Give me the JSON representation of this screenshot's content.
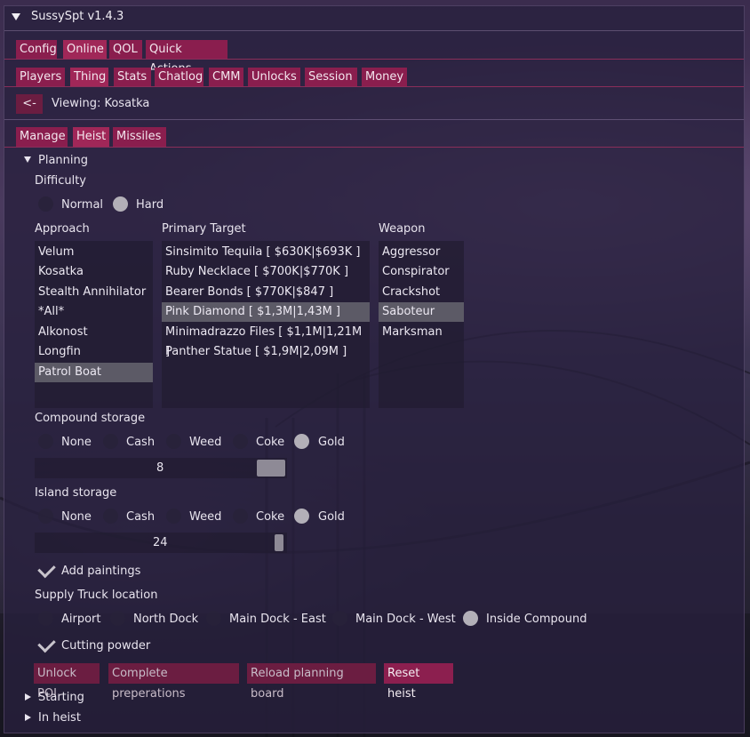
{
  "window": {
    "title": "SussySpt v1.4.3"
  },
  "tabs_row1": [
    "Config",
    "Online",
    "QOL",
    "Quick Actions"
  ],
  "tabs_row2": [
    "Players",
    "Thing",
    "Stats",
    "Chatlog",
    "CMM",
    "Unlocks",
    "Session",
    "Money"
  ],
  "nav": {
    "back_label": "<-",
    "viewing": "Viewing: Kosatka"
  },
  "tabs_row3": [
    "Manage",
    "Heist",
    "Missiles"
  ],
  "planning": {
    "header": "Planning",
    "difficulty_label": "Difficulty",
    "difficulty_options": [
      "Normal",
      "Hard"
    ],
    "difficulty_selected": "Hard",
    "approach_label": "Approach",
    "approach_items": [
      "Velum",
      "Kosatka",
      "Stealth Annihilator",
      "*All*",
      "Alkonost",
      "Longfin",
      "Patrol Boat"
    ],
    "approach_selected": "Patrol Boat",
    "target_label": "Primary Target",
    "target_items": [
      "Sinsimito Tequila [ $630K|$693K ]",
      "Ruby Necklace [ $700K|$770K ]",
      "Bearer Bonds [ $770K|$847 ]",
      "Pink Diamond [ $1,3M|1,43M ]",
      "Minimadrazzo Files [ $1,1M|1,21M ]",
      "Panther Statue [ $1,9M|2,09M ]"
    ],
    "target_selected": "Pink Diamond [ $1,3M|1,43M ]",
    "weapon_label": "Weapon",
    "weapon_items": [
      "Aggressor",
      "Conspirator",
      "Crackshot",
      "Saboteur",
      "Marksman"
    ],
    "weapon_selected": "Saboteur",
    "compound_storage_label": "Compound storage",
    "compound_storage_options": [
      "None",
      "Cash",
      "Weed",
      "Coke",
      "Gold"
    ],
    "compound_storage_selected": "Gold",
    "compound_slider_value": "8",
    "island_storage_label": "Island storage",
    "island_storage_options": [
      "None",
      "Cash",
      "Weed",
      "Coke",
      "Gold"
    ],
    "island_storage_selected": "Gold",
    "island_slider_value": "24",
    "add_paintings_label": "Add paintings",
    "add_paintings_checked": true,
    "supply_truck_label": "Supply Truck location",
    "supply_truck_options": [
      "Airport",
      "North Dock",
      "Main Dock - East",
      "Main Dock - West",
      "Inside Compound"
    ],
    "supply_truck_selected": "Inside Compound",
    "cutting_powder_label": "Cutting powder",
    "cutting_powder_checked": true,
    "actions": [
      "Unlock POI",
      "Complete preperations",
      "Reload planning board",
      "Reset heist"
    ]
  },
  "sections": [
    "Starting",
    "In heist"
  ],
  "colors": {
    "tab": "#8a1e4e",
    "tab_active": "#a02758",
    "separator": "#8b2e5a",
    "selected_item": "#5c5a66"
  }
}
